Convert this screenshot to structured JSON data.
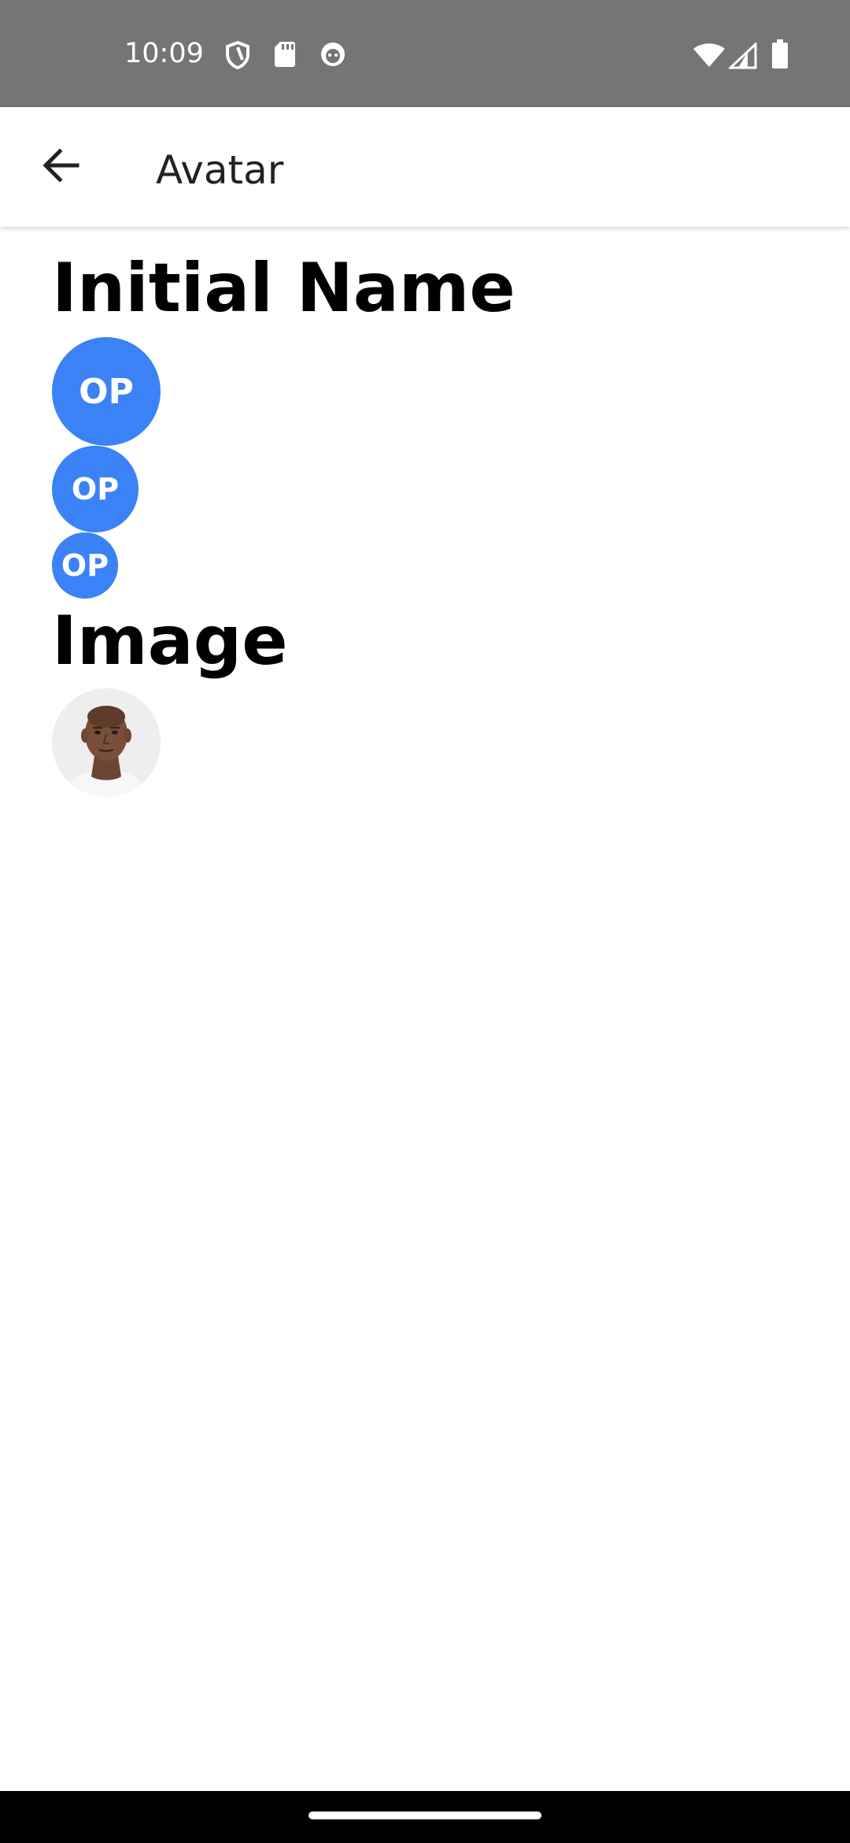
{
  "status_bar": {
    "time": "10:09",
    "left_icons": [
      "shield-icon",
      "sd-card-icon",
      "notification-face-icon"
    ],
    "right_icons": [
      "wifi-icon",
      "cell-signal-icon",
      "battery-icon"
    ]
  },
  "app_bar": {
    "title": "Avatar",
    "back_icon": "arrow-left-icon"
  },
  "sections": {
    "initial_name": {
      "heading": "Initial Name",
      "avatars": [
        {
          "initials": "OP",
          "size": "large"
        },
        {
          "initials": "OP",
          "size": "medium"
        },
        {
          "initials": "OP",
          "size": "small"
        }
      ]
    },
    "image": {
      "heading": "Image",
      "avatar_icon": "person-photo"
    }
  },
  "colors": {
    "avatar_bg": "#3B82F6",
    "status_bar_bg": "#757575",
    "nav_bar_bg": "#000000"
  }
}
